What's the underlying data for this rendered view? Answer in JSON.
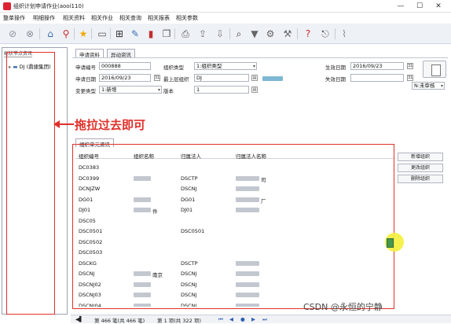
{
  "window": {
    "title": "组织计划申请作业(aooi110)",
    "minimize": "—",
    "maximize": "☐",
    "close": "✕"
  },
  "menu": [
    "整单操作",
    "明细操作",
    "相关资料",
    "相关作业",
    "相关查询",
    "相关报表",
    "相关参数"
  ],
  "toolbar_icons": [
    "check-icon",
    "cancel-icon",
    "home-icon",
    "location-pin-icon",
    "star-icon",
    "document-icon",
    "new-icon",
    "edit-icon",
    "delete-icon",
    "copy-icon",
    "print-icon",
    "export-icon",
    "import-icon",
    "search-icon",
    "filter-icon",
    "settings-icon",
    "tools-icon",
    "help-icon",
    "exit-icon",
    "attachment-icon"
  ],
  "left": {
    "tab": "树状节点资讯",
    "node": "DJ (鼎捷集团)"
  },
  "tabs": {
    "main": "申请资料",
    "other": "异动资讯"
  },
  "form": {
    "apply_no_label": "申请编号",
    "apply_no": "000888",
    "org_type_label": "组织类型",
    "org_type": "1:组织类型",
    "eff_date_label": "生效日期",
    "eff_date": "2016/09/23",
    "apply_date_label": "申请日期",
    "apply_date": "2016/09/23",
    "top_org_label": "最上层组织",
    "top_org": "DJ",
    "inv_date_label": "失效日期",
    "change_type_label": "变更类型",
    "change_type": "1:新增",
    "version_label": "版本",
    "version": "1",
    "status": "N:未审核"
  },
  "annotation": "拖拉过去即可",
  "grid": {
    "tab": "组织单元资讯",
    "headers": [
      "组织编号",
      "组织名称",
      "归属法人",
      "归属法人名称"
    ],
    "rows": [
      [
        "DC0383",
        "",
        "",
        ""
      ],
      [
        "DC0399",
        "",
        "DSCTP",
        "司"
      ],
      [
        "DCNJZW",
        "",
        "DSCNJ",
        ""
      ],
      [
        "DG01",
        "",
        "DG01",
        "厂"
      ],
      [
        "DJ01",
        "件",
        "DJ01",
        ""
      ],
      [
        "DSC05",
        "",
        "",
        ""
      ],
      [
        "DSC0501",
        "",
        "DSC0501",
        ""
      ],
      [
        "DSC0502",
        "",
        "",
        ""
      ],
      [
        "DSC0503",
        "",
        "",
        ""
      ],
      [
        "DSCKG",
        "",
        "DSCTP",
        ""
      ],
      [
        "DSCNJ",
        "南京",
        "DSCNJ",
        ""
      ],
      [
        "DSCNJ02",
        "",
        "DSCNJ",
        ""
      ],
      [
        "DSCNJ03",
        "",
        "DSCNJ",
        ""
      ],
      [
        "DSCNJ04",
        "",
        "DSCNJ",
        ""
      ]
    ],
    "blur_name_rows": [
      1,
      3,
      4,
      10,
      11,
      12,
      13
    ],
    "blur_owner_rows": [
      1,
      2,
      3,
      4,
      9,
      10,
      11,
      12,
      13
    ]
  },
  "right_buttons": [
    "新增组织",
    "更改组织",
    "删除组织"
  ],
  "status": {
    "total": "第 466 笔(共 466 笔)",
    "page": "第 1 项(共 322 项)"
  },
  "watermark": "CSDN @永恒的宁静"
}
